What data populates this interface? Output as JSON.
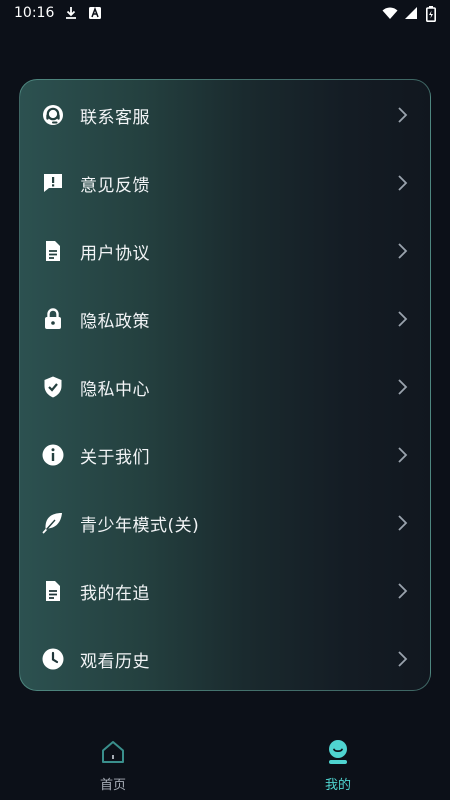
{
  "status_bar": {
    "time": "10:16",
    "left_icons": [
      "download-icon",
      "notification-a-icon"
    ],
    "right_icons": [
      "wifi-icon",
      "signal-icon",
      "battery-icon"
    ]
  },
  "menu": {
    "items": [
      {
        "label": "联系客服",
        "icon": "customer-service-icon"
      },
      {
        "label": "意见反馈",
        "icon": "feedback-icon"
      },
      {
        "label": "用户协议",
        "icon": "document-icon"
      },
      {
        "label": "隐私政策",
        "icon": "lock-icon"
      },
      {
        "label": "隐私中心",
        "icon": "shield-icon"
      },
      {
        "label": "关于我们",
        "icon": "info-icon"
      },
      {
        "label": "青少年模式(关)",
        "icon": "leaf-icon"
      },
      {
        "label": "我的在追",
        "icon": "document-icon"
      },
      {
        "label": "观看历史",
        "icon": "clock-icon"
      }
    ]
  },
  "bottom_nav": {
    "tabs": [
      {
        "label": "首页",
        "icon": "home-icon",
        "active": false
      },
      {
        "label": "我的",
        "icon": "profile-icon",
        "active": true
      }
    ]
  },
  "colors": {
    "background": "#0c1018",
    "card_border": "#78c8b9",
    "active_tab": "#4fd4d0",
    "inactive_tab": "#a7adb6",
    "chevron": "#9aa3ad",
    "icon": "#ffffff"
  }
}
